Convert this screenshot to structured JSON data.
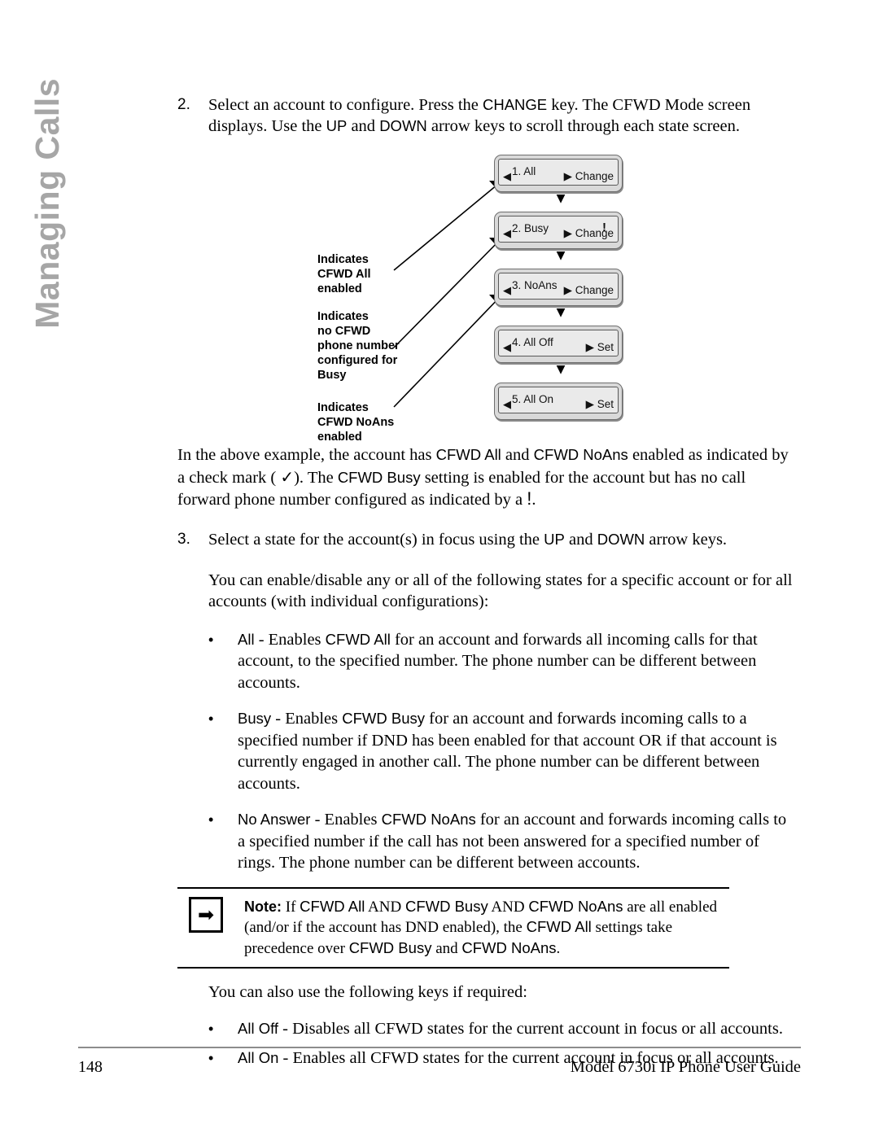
{
  "side_tab": {
    "label": "Managing Calls"
  },
  "steps": [
    {
      "number": "2.",
      "text_parts": [
        {
          "t": "Select an account to configure. Press the ",
          "style": "serif"
        },
        {
          "t": "CHANGE",
          "style": "ui"
        },
        {
          "t": " key. The CFWD Mode screen displays. Use the ",
          "style": "serif"
        },
        {
          "t": "UP",
          "style": "ui"
        },
        {
          "t": " and ",
          "style": "serif"
        },
        {
          "t": "DOWN",
          "style": "ui"
        },
        {
          "t": " arrow keys to scroll through each state screen.",
          "style": "serif"
        }
      ]
    },
    {
      "number": "3.",
      "text_parts": [
        {
          "t": "Select a state for the account(s) in focus using the ",
          "style": "serif"
        },
        {
          "t": "UP",
          "style": "ui"
        },
        {
          "t": " and ",
          "style": "serif"
        },
        {
          "t": "DOWN",
          "style": "ui"
        },
        {
          "t": " arrow keys.",
          "style": "serif"
        }
      ]
    }
  ],
  "diagram": {
    "callouts": [
      {
        "id": "cfwd-all-enabled",
        "text": "Indicates\nCFWD All\nenabled"
      },
      {
        "id": "no-cfwd-number-busy",
        "text": "Indicates\nno CFWD\nphone number\nconfigured for\nBusy"
      },
      {
        "id": "cfwd-noans-enabled",
        "text": "Indicates\nCFWD NoAns\nenabled"
      }
    ],
    "screens": [
      {
        "label": "1.  All",
        "state_indicator": "",
        "soft_left": "◀",
        "soft_right": "▶ Change"
      },
      {
        "label": "2.  Busy",
        "state_indicator": "!",
        "soft_left": "◀",
        "soft_right": "▶ Change"
      },
      {
        "label": "3.  NoAns",
        "state_indicator": "",
        "soft_left": "◀",
        "soft_right": "▶ Change"
      },
      {
        "label": "4.  All Off",
        "state_indicator": "",
        "soft_left": "◀",
        "soft_right": "▶ Set"
      },
      {
        "label": "5.  All On",
        "state_indicator": "",
        "soft_left": "◀",
        "soft_right": "▶ Set"
      }
    ],
    "flow_arrow": "▼"
  },
  "example_paragraph": [
    {
      "t": "In the above example, the account has ",
      "style": "serif"
    },
    {
      "t": "CFWD All",
      "style": "ui"
    },
    {
      "t": "  and ",
      "style": "serif"
    },
    {
      "t": "CFWD NoAns",
      "style": "ui"
    },
    {
      "t": " enabled as indicated by a check mark ( ",
      "style": "serif"
    },
    {
      "t": "✓",
      "style": "check"
    },
    {
      "t": "). The ",
      "style": "serif"
    },
    {
      "t": "CFWD Busy",
      "style": "ui"
    },
    {
      "t": " setting is enabled for the account but has no call forward phone number configured as indicated by a ",
      "style": "serif"
    },
    {
      "t": "!",
      "style": "bang"
    },
    {
      "t": ".",
      "style": "serif"
    }
  ],
  "states_intro": "You can enable/disable any or all of the following states for a specific account or for all accounts (with individual configurations):",
  "state_bullets": [
    {
      "marker": "•",
      "parts": [
        {
          "t": "All",
          "style": "ui"
        },
        {
          "t": " - Enables ",
          "style": "serif"
        },
        {
          "t": "CFWD All",
          "style": "ui"
        },
        {
          "t": "  for an account and forwards all incoming calls for that account, to the specified number. The phone number can be different between accounts.",
          "style": "serif"
        }
      ]
    },
    {
      "marker": "•",
      "parts": [
        {
          "t": "Busy",
          "style": "ui"
        },
        {
          "t": " - Enables ",
          "style": "serif"
        },
        {
          "t": "CFWD Busy",
          "style": "ui"
        },
        {
          "t": " for an account and forwards incoming calls to a specified number if DND has been enabled for that account OR if that account is currently engaged in another call. The phone number can be different between accounts.",
          "style": "serif"
        }
      ]
    },
    {
      "marker": "•",
      "parts": [
        {
          "t": "No Answer",
          "style": "ui"
        },
        {
          "t": " - Enables ",
          "style": "serif"
        },
        {
          "t": "CFWD NoAns",
          "style": "ui"
        },
        {
          "t": " for an account and forwards incoming calls to a specified number if the call has not been answered for a specified number of rings. The phone number can be different between accounts.",
          "style": "serif"
        }
      ]
    }
  ],
  "note": {
    "icon": "➡",
    "label": "Note:",
    "parts": [
      {
        "t": " If ",
        "style": "serif"
      },
      {
        "t": "CFWD All",
        "style": "ui"
      },
      {
        "t": "  AND ",
        "style": "serif"
      },
      {
        "t": "CFWD Busy",
        "style": "ui"
      },
      {
        "t": " AND ",
        "style": "serif"
      },
      {
        "t": "CFWD NoAns",
        "style": "ui"
      },
      {
        "t": " are all enabled (and/or if the account has DND enabled), the ",
        "style": "serif"
      },
      {
        "t": "CFWD All",
        "style": "ui"
      },
      {
        "t": "  settings take precedence over ",
        "style": "serif"
      },
      {
        "t": "CFWD Busy",
        "style": "ui"
      },
      {
        "t": " and ",
        "style": "serif"
      },
      {
        "t": "CFWD NoAns",
        "style": "ui"
      },
      {
        "t": ".",
        "style": "serif"
      }
    ]
  },
  "keys_intro": "You can also use the following keys if required:",
  "key_bullets": [
    {
      "marker": "•",
      "parts": [
        {
          "t": "All Off",
          "style": "ui"
        },
        {
          "t": "  - Disables all CFWD states for the current account in focus or all accounts.",
          "style": "serif"
        }
      ]
    },
    {
      "marker": "•",
      "parts": [
        {
          "t": "All On",
          "style": "ui"
        },
        {
          "t": " - Enables all CFWD states for the current account in focus or all accounts.",
          "style": "serif"
        }
      ]
    }
  ],
  "footer": {
    "page_number": "148",
    "guide_title": "Model 6730i IP Phone User Guide"
  }
}
